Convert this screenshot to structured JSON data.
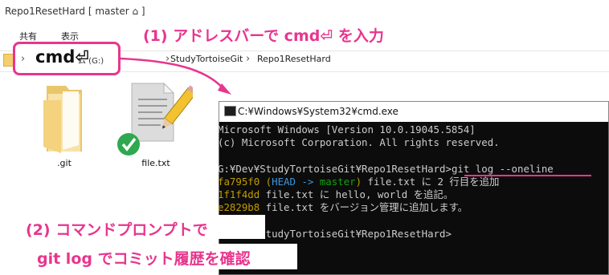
{
  "explorer": {
    "title": "Repo1ResetHard [ master ⌂ ]",
    "ribbon_tabs": [
      "共有",
      "表示"
    ],
    "address_typed": "cmd⏎",
    "address_drive_label": "ム (G:)",
    "breadcrumbs": [
      "StudyTortoiseGit",
      "Repo1ResetHard"
    ],
    "items": [
      {
        "name": ".git",
        "icon": "folder-icon"
      },
      {
        "name": "file.txt",
        "icon": "text-file-icon"
      }
    ]
  },
  "cmd": {
    "title": "C:¥Windows¥System32¥cmd.exe",
    "banner_line1": "Microsoft Windows [Version 10.0.19045.5854]",
    "banner_line2": "(c) Microsoft Corporation. All rights reserved.",
    "prompt1": "G:¥Dev¥StudyTortoiseGit¥Repo1ResetHard>",
    "command": "git log --oneline",
    "log": [
      {
        "hash": "fa795f0",
        "refs_open": " (",
        "head": "HEAD -> ",
        "branch": "master",
        "refs_close": ")",
        "message": " file.txt に 2 行目を追加"
      },
      {
        "hash": "1f1f4dd",
        "message": " file.txt に hello, world を追記。"
      },
      {
        "hash": "e2829b8",
        "message": " file.txt をバージョン管理に追加します。"
      }
    ],
    "prompt2": "G:¥Dev¥StudyTortoiseGit¥Repo1ResetHard>"
  },
  "annotations": {
    "step1": "(1) アドレスバーで cmd⏎ を入力",
    "step2_line1": "(2) コマンドプロンプトで",
    "step2_line2": "git log でコミット履歴を確認"
  },
  "colors": {
    "annotation": "#e8358e",
    "hash": "#c19c00",
    "head_ref": "#3a96dd",
    "branch_ref": "#13a10e"
  }
}
